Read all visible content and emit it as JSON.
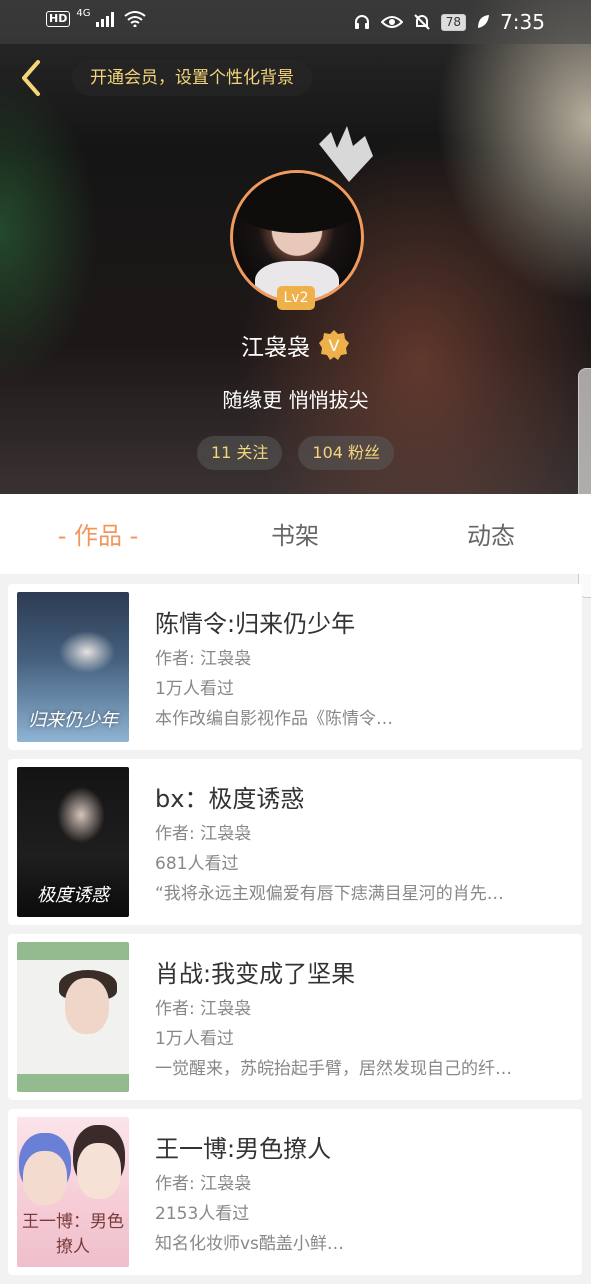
{
  "status_bar": {
    "hd": "HD",
    "network": "4G",
    "battery": "78",
    "time": "7:35"
  },
  "header": {
    "vip_banner": "开通会员，设置个性化背景",
    "level": "Lv2",
    "username": "江袅袅",
    "verified_badge": "V",
    "signature": "随缘更 悄悄拔尖",
    "following": "11 关注",
    "followers": "104 粉丝"
  },
  "tabs": [
    {
      "label": "- 作品 -",
      "active": true
    },
    {
      "label": "书架",
      "active": false
    },
    {
      "label": "动态",
      "active": false
    }
  ],
  "works": [
    {
      "title": "陈情令:归来仍少年",
      "author": "作者: 江袅袅",
      "views": "1万人看过",
      "desc": "本作改编自影视作品《陈情令…",
      "cover_text": "归来仍少年"
    },
    {
      "title": "bx：极度诱惑",
      "author": "作者: 江袅袅",
      "views": "681人看过",
      "desc": "“我将永远主观偏爱有唇下痣满目星河的肖先…",
      "cover_text": "极度诱惑"
    },
    {
      "title": "肖战:我变成了坚果",
      "author": "作者: 江袅袅",
      "views": "1万人看过",
      "desc": "一觉醒来，苏皖抬起手臂，居然发现自己的纤…",
      "cover_text": ""
    },
    {
      "title": "王一博:男色撩人",
      "author": "作者: 江袅袅",
      "views": "2153人看过",
      "desc": "知名化妆师vs酷盖小鲜…",
      "cover_text": "王一博：男色撩人"
    }
  ],
  "colors": {
    "accent": "#f2965c",
    "gold": "#f4d57a",
    "level_badge": "#eeb14a"
  }
}
